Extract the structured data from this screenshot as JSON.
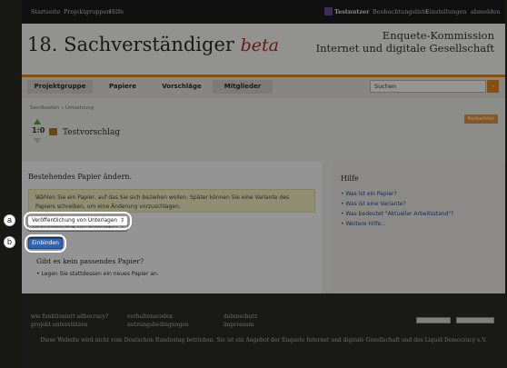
{
  "topbar": {
    "left_links": [
      "Startseite",
      "Projektgruppen",
      "Hilfe"
    ],
    "user": "Testnutzer",
    "right_links": [
      "Beobachtungsliste",
      "Einstellungen",
      "abmelden"
    ]
  },
  "header": {
    "logo_text": "18. Sachverständiger",
    "logo_beta": "beta",
    "subtitle_line1": "Enquete-Kommission",
    "subtitle_line2": "Internet und digitale Gesellschaft"
  },
  "nav": {
    "tabs": [
      {
        "label": "Projektgruppe",
        "active": true
      },
      {
        "label": "Papiere",
        "active": false
      },
      {
        "label": "Vorschläge",
        "active": false
      },
      {
        "label": "Mitglieder",
        "active": true
      }
    ],
    "search_placeholder": "Suchen",
    "search_button": "›"
  },
  "breadcrumb": "Sandkasten » Umsetzung",
  "breadcrumb_button": "Beobachten",
  "proposal": {
    "vote_count": "1:0",
    "title": "Testvorschlag"
  },
  "form": {
    "heading": "Bestehendes Papier ändern.",
    "notice": "Wählen Sie ein Papier, auf das Sie sich beziehen wollen. Später können Sie eine Variante des Papiers schreiben, um eine Änderung vorzuschlagen.",
    "select_value": "Veröffentlichung von Unterlagen",
    "embed_button": "Einbinden",
    "sub_heading": "Gibt es kein passendes Papier?",
    "sub_item": "Legen Sie stattdessen ein neues Papier an."
  },
  "help": {
    "heading": "Hilfe",
    "items": [
      "Was ist ein Papier?",
      "Was ist eine Variante?",
      "Was bedeutet \"Aktueller Arbeitsstand\"?",
      "Weitere Hilfe..."
    ]
  },
  "footer": {
    "col1": [
      "wie funktioniert adhocracy?",
      "projekt unterstützen"
    ],
    "col2": [
      "verhaltenscodex",
      "nutzungsbedingungen"
    ],
    "col3": [
      "datenschutz",
      "impressum"
    ],
    "text": "Diese Website wird nicht vom Deutschen Bundestag betrieben. Sie ist ein Angebot der Enquete Internet und digitale Gesellschaft und des Liquid Democracy e.V."
  },
  "markers": {
    "a": "a",
    "b": "b"
  },
  "colors": {
    "accent_orange": "#e38a1e",
    "button_blue": "#2f63b6",
    "beta_red": "#c0281e"
  }
}
